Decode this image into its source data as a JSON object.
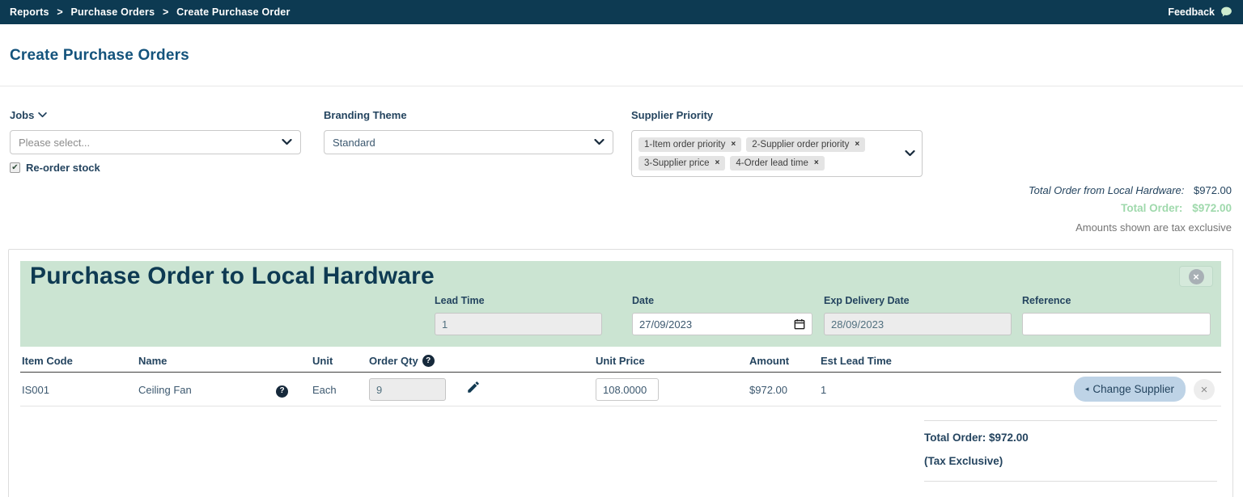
{
  "nav": {
    "breadcrumb": [
      "Reports",
      "Purchase Orders",
      "Create Purchase Order"
    ],
    "separator": ">",
    "feedback_label": "Feedback"
  },
  "page": {
    "title": "Create Purchase Orders"
  },
  "filters": {
    "jobs_label": "Jobs",
    "jobs_placeholder": "Please select...",
    "reorder_label": "Re-order stock",
    "branding_label": "Branding Theme",
    "branding_value": "Standard",
    "supplier_priority_label": "Supplier Priority",
    "priority_tags": {
      "t0": "1-Item order priority",
      "t1": "2-Supplier order priority",
      "t2": "3-Supplier price",
      "t3": "4-Order lead time"
    }
  },
  "summary": {
    "supplier_total_label": "Total Order from Local Hardware:",
    "supplier_total_value": "$972.00",
    "total_label": "Total Order:",
    "total_value": "$972.00",
    "tax_note": "Amounts shown are tax exclusive"
  },
  "order": {
    "title": "Purchase Order to Local Hardware",
    "lead_time_label": "Lead Time",
    "lead_time_value": "1",
    "date_label": "Date",
    "date_value": "27/09/2023",
    "exp_delivery_label": "Exp Delivery Date",
    "exp_delivery_value": "28/09/2023",
    "reference_label": "Reference",
    "reference_value": "",
    "table": {
      "headers": {
        "item_code": "Item Code",
        "name": "Name",
        "unit": "Unit",
        "order_qty": "Order Qty",
        "unit_price": "Unit Price",
        "amount": "Amount",
        "est_lead_time": "Est Lead Time"
      },
      "row": {
        "item_code": "IS001",
        "name": "Ceiling Fan",
        "unit": "Each",
        "order_qty": "9",
        "unit_price": "108.0000",
        "amount": "$972.00",
        "est_lead_time": "1",
        "change_supplier_label": "Change Supplier"
      }
    },
    "footer": {
      "total_line": "Total Order: $972.00",
      "tax_line": "(Tax Exclusive)"
    }
  },
  "icons": {
    "question_glyph": "?",
    "close_glyph": "×",
    "check_glyph": "✔",
    "triangle_left_glyph": "◂"
  },
  "colors": {
    "navbar": "#0d3a52",
    "header_green": "#cbe4d2",
    "total_green": "#9fd9ac",
    "accent_blue": "#bed3e6"
  }
}
